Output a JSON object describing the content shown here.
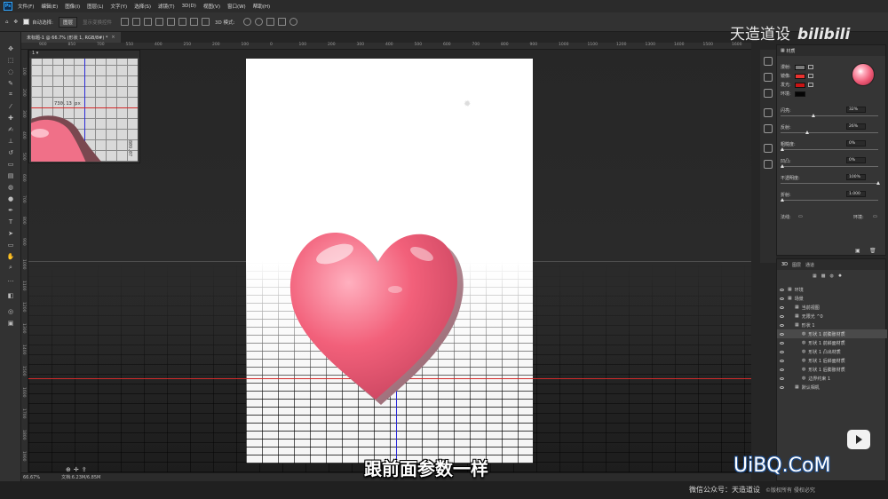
{
  "app": {
    "logo": "Ps"
  },
  "menu": [
    "文件(F)",
    "编辑(E)",
    "图像(I)",
    "图层(L)",
    "文字(Y)",
    "选择(S)",
    "滤镜(T)",
    "3D(D)",
    "视图(V)",
    "窗口(W)",
    "帮助(H)"
  ],
  "options": {
    "auto_select_label": "自动选择:",
    "auto_select_value": "图层",
    "transform_controls": "显示变换控件",
    "mode_3d": "3D 模式:"
  },
  "document": {
    "tab_title": "未标题-1 @ 66.7% (形状 1, RGB/8#) *",
    "close": "×"
  },
  "rulers": {
    "h": [
      "900",
      "850",
      "700",
      "550",
      "400",
      "250",
      "200",
      "100",
      "0",
      "100",
      "200",
      "300",
      "400",
      "500",
      "600",
      "700",
      "800",
      "900",
      "1000",
      "1100",
      "1200",
      "1300",
      "1400",
      "1500",
      "1600"
    ],
    "v": [
      "100",
      "200",
      "300",
      "400",
      "500",
      "600",
      "700",
      "800",
      "900",
      "1000",
      "1100",
      "1200",
      "1300",
      "1400",
      "1500",
      "1600",
      "1700",
      "1800",
      "1900"
    ]
  },
  "navigator": {
    "measure_h": "730.13 px",
    "measure_v": "809.07"
  },
  "status": {
    "zoom": "66.67%",
    "doc_size": "文档:6.23M/6.85M"
  },
  "properties": {
    "tab_label": "材质",
    "rows": [
      {
        "label": "漫射:",
        "color": "#7a7a7a"
      },
      {
        "label": "镜像:",
        "color": "#e8322f"
      },
      {
        "label": "发光:",
        "color": "#c91414"
      },
      {
        "label": "环境:",
        "color": "#050505"
      }
    ],
    "sliders": [
      {
        "label": "闪亮:",
        "value": "32%",
        "level": 0.32
      },
      {
        "label": "反射:",
        "value": "26%",
        "level": 0.26
      },
      {
        "label": "粗糙度:",
        "value": "0%",
        "level": 0.0
      },
      {
        "label": "凹凸:",
        "value": "0%",
        "level": 0.0
      },
      {
        "label": "不透明度:",
        "value": "100%",
        "level": 1.0
      },
      {
        "label": "折射:",
        "value": "1.000",
        "level": 0.0
      }
    ],
    "normal_label": "法线:",
    "env_label": "环境:"
  },
  "layers": {
    "tabs": [
      "3D",
      "图层",
      "通道"
    ],
    "items": [
      {
        "name": "环境",
        "indent": 0
      },
      {
        "name": "场景",
        "indent": 0
      },
      {
        "name": "当前视图",
        "indent": 1
      },
      {
        "name": "无限光 ^0",
        "indent": 1
      },
      {
        "name": "形状 1",
        "indent": 1
      },
      {
        "name": "形状 1 前膨胀材质",
        "indent": 2,
        "selected": true
      },
      {
        "name": "形状 1 前斜面材质",
        "indent": 2
      },
      {
        "name": "形状 1 凸出材质",
        "indent": 2
      },
      {
        "name": "形状 1 后斜面材质",
        "indent": 2
      },
      {
        "name": "形状 1 后膨胀材质",
        "indent": 2
      },
      {
        "name": "边界约束 1",
        "indent": 2
      },
      {
        "name": "默认相机",
        "indent": 1
      }
    ]
  },
  "overlay": {
    "watermark_text": "天造道设",
    "watermark_brand": "bilibili",
    "subtitle": "跟前面参数一样",
    "uibq": "UiBQ.CoM",
    "footer_main": "微信公众号：天造道设",
    "footer_small": "©版权所有 侵权必究"
  },
  "colors": {
    "heart_light": "#ffb0bf",
    "heart_main": "#f2607a",
    "heart_dark": "#b93552",
    "axis_red": "#d32a2a",
    "axis_blue": "#2a2ad8"
  }
}
